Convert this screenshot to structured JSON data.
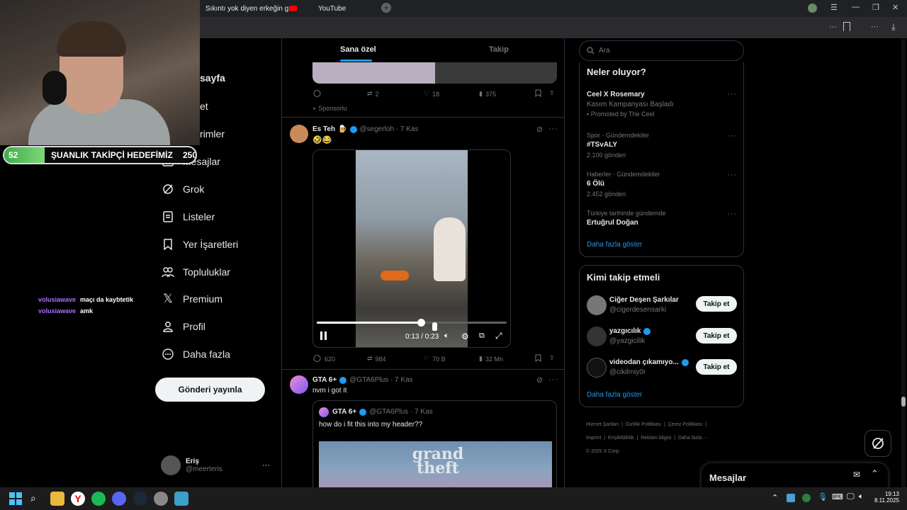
{
  "browser": {
    "tab1_title": "Sıkıntı yok diyen erkeğin g",
    "tab2_title": "YouTube"
  },
  "stream": {
    "goal_current": "52",
    "goal_label": "ŞUANLIK TAKİPÇİ HEDEFİMİZ",
    "goal_target": "250",
    "goal_fraction": 0.21,
    "chat": [
      {
        "user": "volusiawave",
        "msg": "maçı da kaybtetik"
      },
      {
        "user": "volusiawave",
        "msg": "amk"
      }
    ]
  },
  "nav": {
    "home_partial": "sayfa",
    "explore_partial": "et",
    "notif_partial": "rimler",
    "messages": "Mesajlar",
    "grok": "Grok",
    "lists": "Listeler",
    "bookmarks": "Yer İşaretleri",
    "communities": "Topluluklar",
    "premium": "Premium",
    "profile": "Profil",
    "more": "Daha fazla",
    "post_button": "Gönderi yayınla",
    "user_name": "Eriş",
    "user_handle": "@meerteris",
    "user_more": "···"
  },
  "feed": {
    "tab_for_you": "Sana özel",
    "tab_following": "Takip",
    "post0": {
      "replies": "",
      "reposts": "2",
      "likes": "18",
      "views": "375",
      "sponsored": "Sponsorlu"
    },
    "post1": {
      "name": "Es Teh",
      "emoji": "🍺",
      "handle": "@segerloh · 7 Kas",
      "text": "🤣😂",
      "video_time": "0:13 / 0:23",
      "video_progress": 0.55,
      "replies": "620",
      "reposts": "984",
      "likes": "70 B",
      "views": "32 Mn"
    },
    "post2": {
      "name": "GTA 6+",
      "handle": "@GTA6Plus · 7 Kas",
      "text": "nvm i got it",
      "quote_name": "GTA 6+",
      "quote_handle": "@GTA6Plus · 7 Kas",
      "quote_text": "how do i fit this into my header??"
    }
  },
  "right": {
    "search_placeholder": "Ara",
    "trends_title": "Neler oluyor?",
    "trend1_title": "Ceel X Rosemary",
    "trend1_sub": "Kasım Kampanyası Başladı",
    "trend1_promo": "Promoted by The Ceel",
    "trend2_ctx": "Spor · Gündemdekiler",
    "trend2_title": "#TSvALY",
    "trend2_count": "2.100 gönderi",
    "trend3_ctx": "Haberler · Gündemdekiler",
    "trend3_title": "6 Ölü",
    "trend3_count": "2.452 gönderi",
    "trend4_ctx": "Türkiye tarihinde gündemde",
    "trend4_title": "Ertuğrul Doğan",
    "show_more": "Daha fazla göster",
    "who_title": "Kimi takip etmeli",
    "who": [
      {
        "name": "Ciğer Deşen Şarkılar",
        "handle": "@cigerdesensarki",
        "btn": "Takip et"
      },
      {
        "name": "yazgıcılık",
        "handle": "@yazgicilik",
        "btn": "Takip et"
      },
      {
        "name": "videodan çıkamıyo...",
        "handle": "@cikilmiy0r",
        "btn": "Takip et"
      }
    ],
    "who_more": "Daha fazla göster",
    "footer1": "Hizmet Şartları",
    "footer2": "Gizlilik Politikası",
    "footer3": "Çerez Politikası",
    "footer4": "Imprint",
    "footer5": "Erişilebilirlik",
    "footer6": "Reklam bilgisi",
    "footer7": "Daha fazla ···",
    "copyright": "© 2025 X Corp."
  },
  "messages_dock": {
    "title": "Mesajlar"
  },
  "taskbar": {
    "time": "19:13",
    "date": "8.11.2025"
  },
  "colors": {
    "accent": "#1d9bf0",
    "bg": "#000000",
    "border": "#2f3336",
    "goal_green": "#3fae4a",
    "chat_user": "#a970ff"
  }
}
